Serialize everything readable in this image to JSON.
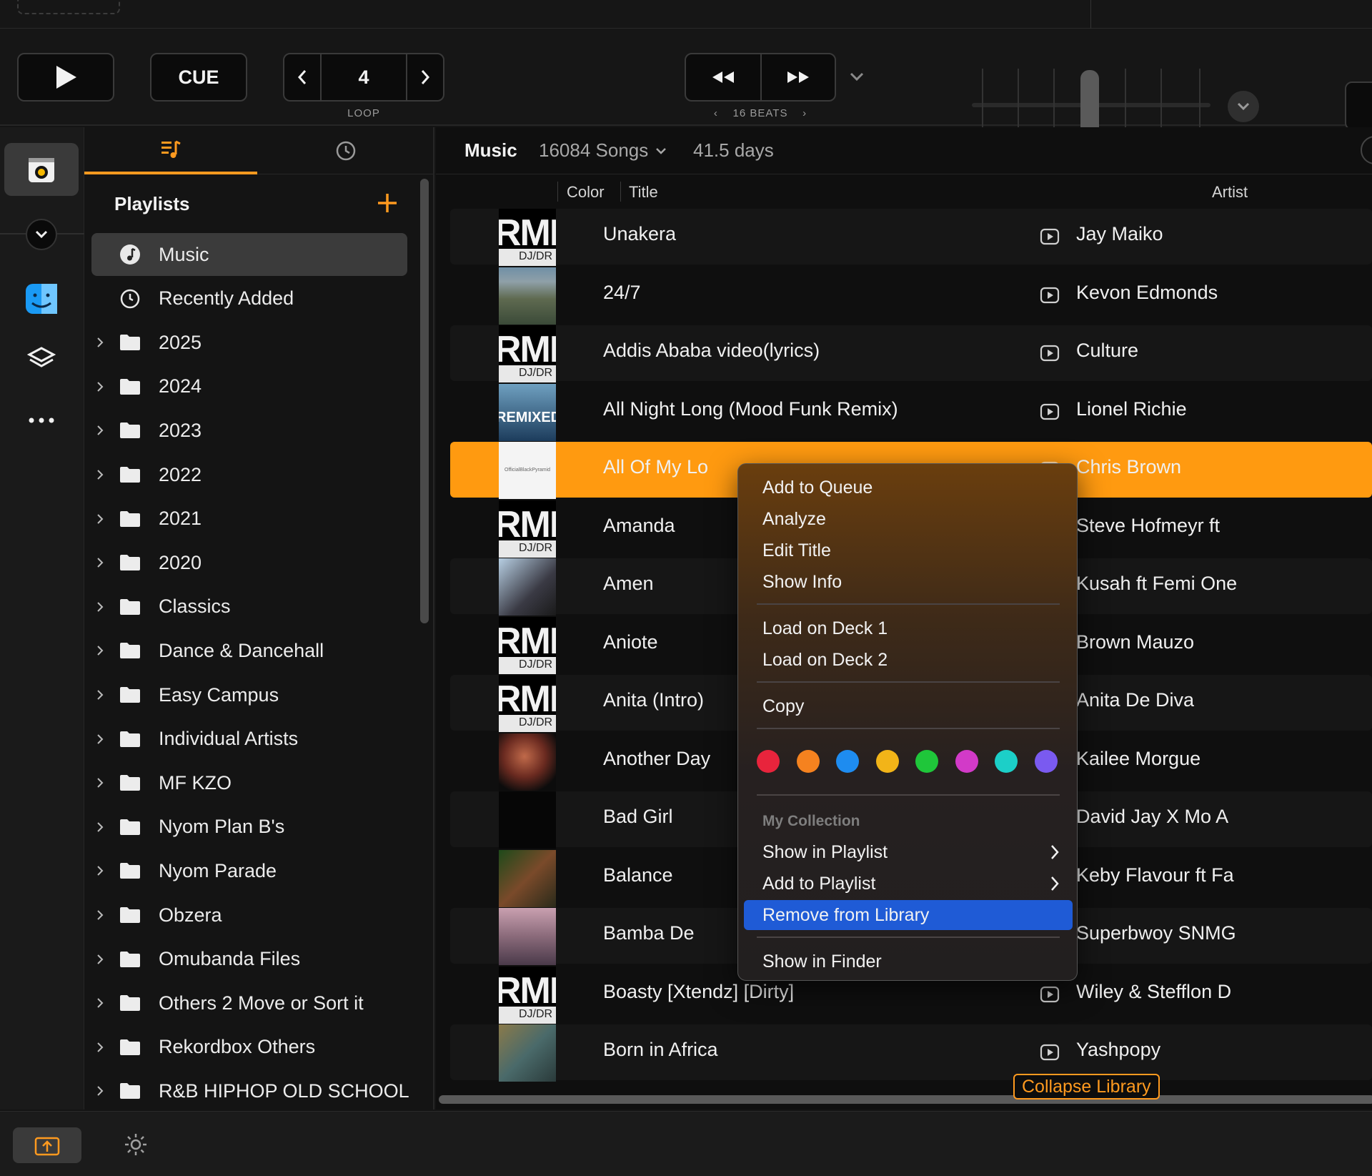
{
  "transport": {
    "cue_label": "CUE",
    "loop_value": "4",
    "loop_label": "LOOP",
    "beats_label": "16 BEATS"
  },
  "playlist_panel": {
    "heading": "Playlists",
    "items": [
      {
        "label": "Music",
        "icon": "music-note-icon",
        "selected": true
      },
      {
        "label": "Recently Added",
        "icon": "clock-icon"
      },
      {
        "label": "2025",
        "icon": "folder-icon"
      },
      {
        "label": "2024",
        "icon": "folder-icon"
      },
      {
        "label": "2023",
        "icon": "folder-icon"
      },
      {
        "label": "2022",
        "icon": "folder-icon"
      },
      {
        "label": "2021",
        "icon": "folder-icon"
      },
      {
        "label": "2020",
        "icon": "folder-icon"
      },
      {
        "label": "Classics",
        "icon": "folder-icon"
      },
      {
        "label": "Dance & Dancehall",
        "icon": "folder-icon"
      },
      {
        "label": "Easy Campus",
        "icon": "folder-icon"
      },
      {
        "label": "Individual Artists",
        "icon": "folder-icon"
      },
      {
        "label": "MF KZO",
        "icon": "folder-icon"
      },
      {
        "label": "Nyom Plan B's",
        "icon": "folder-icon"
      },
      {
        "label": "Nyom Parade",
        "icon": "folder-icon"
      },
      {
        "label": "Obzera",
        "icon": "folder-icon"
      },
      {
        "label": "Omubanda Files",
        "icon": "folder-icon"
      },
      {
        "label": "Others 2 Move or Sort it",
        "icon": "folder-icon"
      },
      {
        "label": "Rekordbox Others",
        "icon": "folder-icon"
      },
      {
        "label": "R&B HIPHOP OLD SCHOOL",
        "icon": "folder-icon"
      }
    ]
  },
  "library": {
    "name": "Music",
    "song_count": "16084 Songs",
    "duration": "41.5 days",
    "columns": {
      "color": "Color",
      "title": "Title",
      "artist": "Artist"
    },
    "tracks": [
      {
        "title": "Unakera",
        "artist": "Jay Maiko",
        "art": "mix"
      },
      {
        "title": "24/7",
        "artist": "Kevon Edmonds",
        "art": "land"
      },
      {
        "title": "Addis Ababa video(lyrics)",
        "artist": "Culture",
        "art": "mix"
      },
      {
        "title": "All Night Long (Mood Funk Remix)",
        "artist": "Lionel Richie",
        "art": "remix"
      },
      {
        "title": "All Of My Lo",
        "artist": "Chris Brown",
        "art": "white",
        "selected": true
      },
      {
        "title": "Amanda",
        "artist": "Steve Hofmeyr ft",
        "art": "mix"
      },
      {
        "title": "Amen",
        "artist": "Kusah ft Femi One",
        "art": "people"
      },
      {
        "title": "Aniote",
        "artist": "Brown Mauzo",
        "art": "mix"
      },
      {
        "title": "Anita (Intro)",
        "artist": "Anita De Diva",
        "art": "mix"
      },
      {
        "title": "Another Day",
        "artist": "Kailee Morgue",
        "art": "portrait"
      },
      {
        "title": "Bad Girl",
        "artist": "David Jay X Mo A",
        "art": "dark"
      },
      {
        "title": "Balance",
        "artist": "Keby Flavour ft Fa",
        "art": "jungle"
      },
      {
        "title": "Bamba De",
        "artist": "Superbwoy SNMG",
        "art": "beach"
      },
      {
        "title": "Boasty [Xtendz]  [Dirty]",
        "artist": "Wiley & Stefflon D",
        "art": "mix"
      },
      {
        "title": "Born in Africa",
        "artist": "Yashpopy",
        "art": "market"
      }
    ],
    "art_text": {
      "mix_big": "RMIX",
      "mix_small": "DJ/DR",
      "remix": "REMIXED",
      "white": "OfficialBlackPyramid"
    },
    "collapse_label": "Collapse Library"
  },
  "context_menu": {
    "group1": [
      "Add to Queue",
      "Analyze",
      "Edit Title",
      "Show Info"
    ],
    "group2": [
      "Load on Deck 1",
      "Load on Deck 2"
    ],
    "group3": [
      "Copy"
    ],
    "colors": [
      "#e8243c",
      "#f5821f",
      "#1e8cf0",
      "#f2b418",
      "#1fc63a",
      "#d23ac8",
      "#1ccfc8",
      "#7a5af0"
    ],
    "collection_header": "My Collection",
    "show_in_playlist": "Show in Playlist",
    "add_to_playlist": "Add to Playlist",
    "remove_from_library": "Remove from Library",
    "show_in_finder": "Show in Finder"
  },
  "colors": {
    "accent": "#ff9a10",
    "highlight": "#1f5bd6"
  }
}
